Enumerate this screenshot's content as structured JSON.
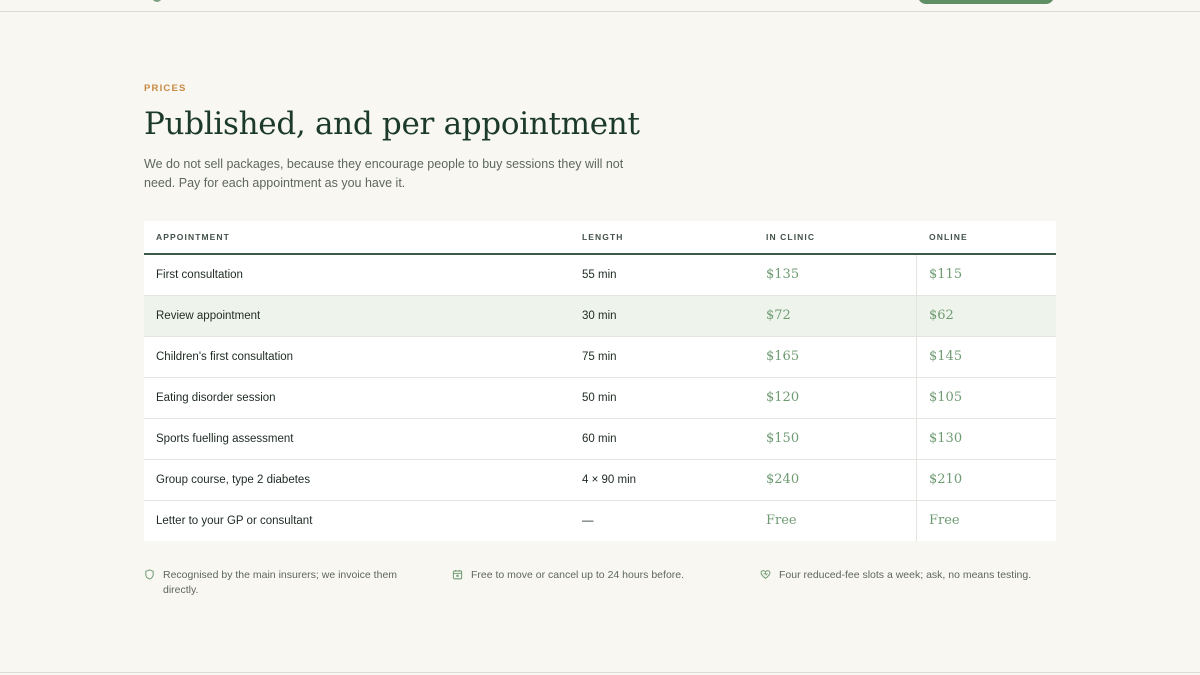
{
  "section": {
    "eyebrow": "PRICES",
    "title": "Published, and per appointment",
    "intro": "We do not sell packages, because they encourage people to buy sessions they will not need. Pay for each appointment as you have it."
  },
  "table": {
    "headers": {
      "appointment": "APPOINTMENT",
      "length": "LENGTH",
      "in_clinic": "IN CLINIC",
      "online": "ONLINE"
    },
    "rows": [
      {
        "name": "First consultation",
        "length": "55 min",
        "in_clinic": "$135",
        "online": "$115"
      },
      {
        "name": "Review appointment",
        "length": "30 min",
        "in_clinic": "$72",
        "online": "$62"
      },
      {
        "name": "Children's first consultation",
        "length": "75 min",
        "in_clinic": "$165",
        "online": "$145"
      },
      {
        "name": "Eating disorder session",
        "length": "50 min",
        "in_clinic": "$120",
        "online": "$105"
      },
      {
        "name": "Sports fuelling assessment",
        "length": "60 min",
        "in_clinic": "$150",
        "online": "$130"
      },
      {
        "name": "Group course, type 2 diabetes",
        "length": "4 × 90 min",
        "in_clinic": "$240",
        "online": "$210"
      },
      {
        "name": "Letter to your GP or consultant",
        "length": "—",
        "in_clinic": "Free",
        "online": "Free"
      }
    ]
  },
  "notes": [
    {
      "icon": "shield-icon",
      "text": "Recognised by the main insurers; we invoice them directly."
    },
    {
      "icon": "calendar-icon",
      "text": "Free to move or cancel up to 24 hours before."
    },
    {
      "icon": "heart-icon",
      "text": "Four reduced-fee slots a week; ask, no means testing."
    }
  ],
  "colors": {
    "accent": "#6f9b73",
    "eyebrow": "#c98a42",
    "heading": "#1c3a2a",
    "highlight_row": "#eef4ec"
  }
}
